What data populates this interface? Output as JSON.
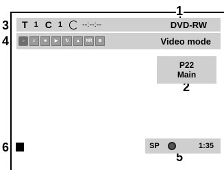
{
  "callouts": {
    "c1": "1",
    "c2": "2",
    "c3": "3",
    "c4": "4",
    "c5": "5",
    "c6": "6"
  },
  "status_bar": {
    "title_letter": "T",
    "title_number": "1",
    "chapter_letter": "C",
    "chapter_number": "1",
    "time": "--:--:--",
    "disc_type": "DVD-RW"
  },
  "icon_bar": {
    "icons": [
      "search-icon",
      "audio-icon",
      "subtitle-icon",
      "angle-icon",
      "repeat-icon",
      "picture-icon",
      "noise-reduction-icon",
      "zoom-icon"
    ],
    "nr_label": "NR",
    "mode": "Video mode"
  },
  "program_box": {
    "program": "P22",
    "type": "Main"
  },
  "playback_status": {
    "speed": "SP",
    "time": "1:35"
  }
}
